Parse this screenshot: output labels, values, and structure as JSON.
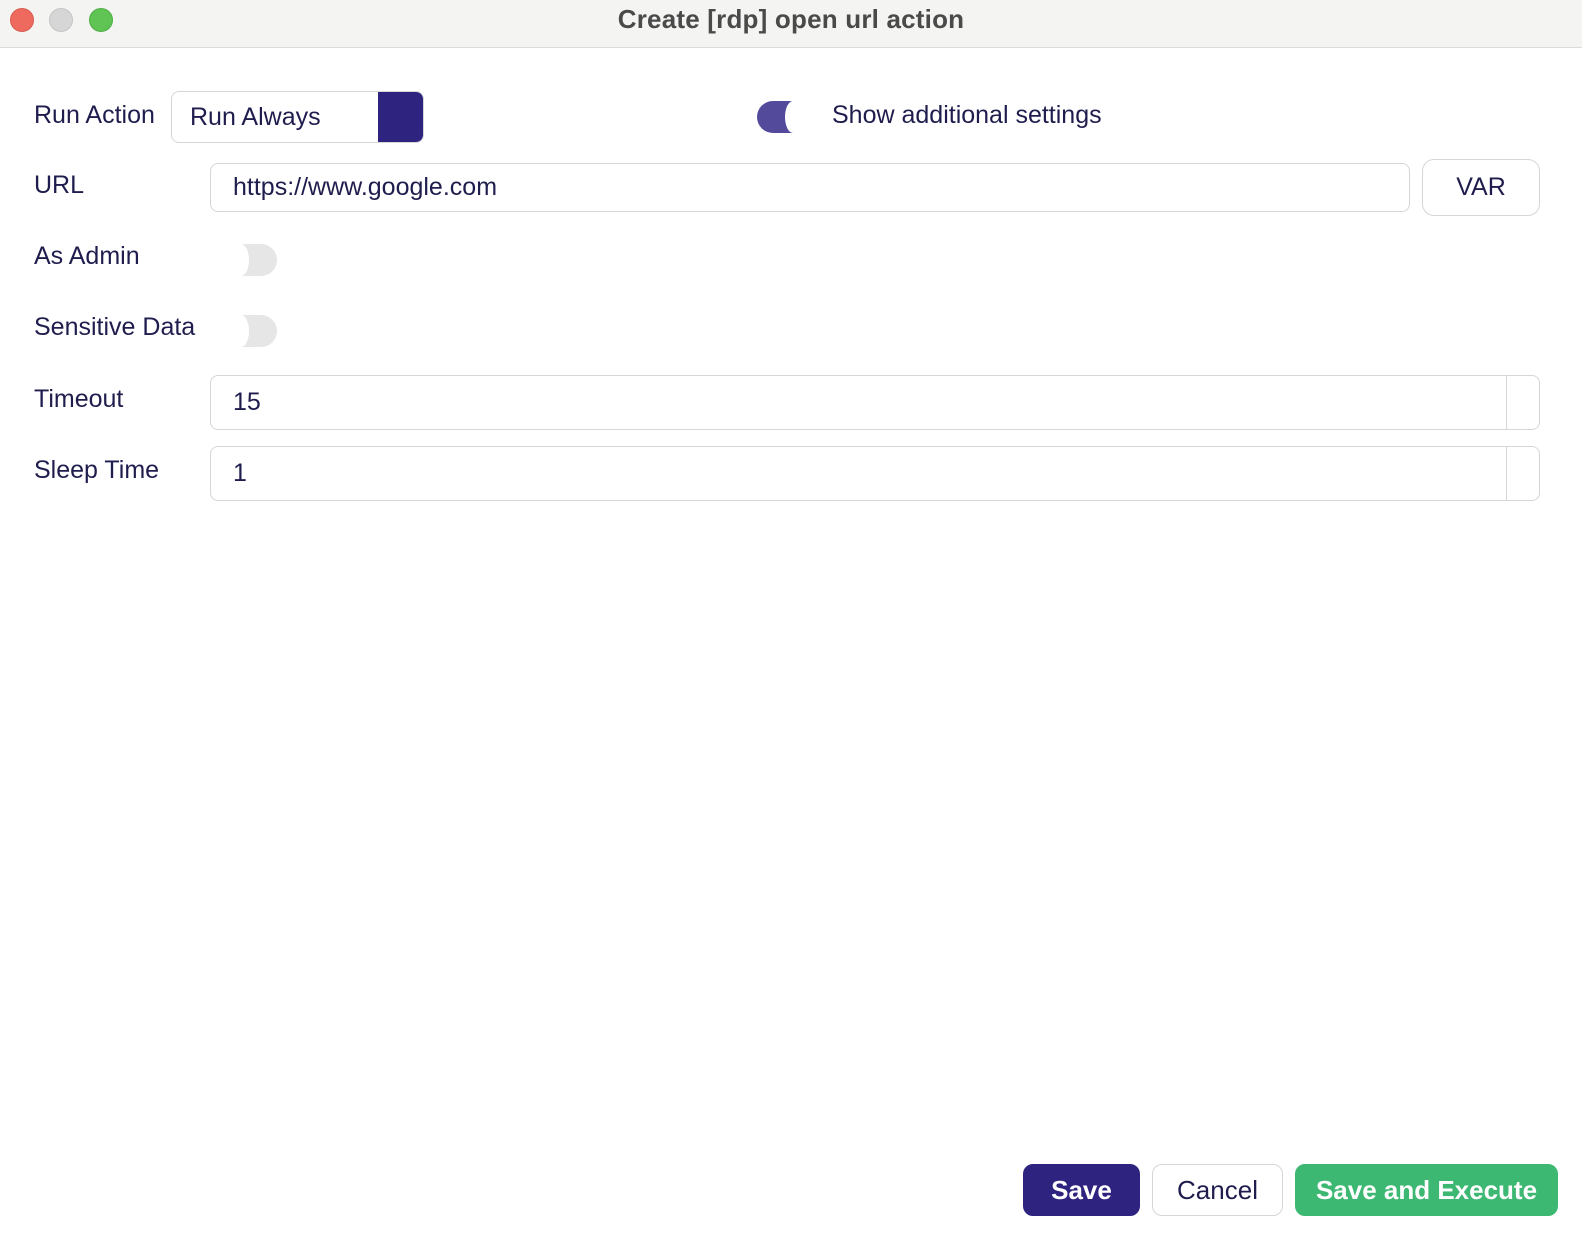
{
  "window": {
    "title": "Create [rdp] open url action"
  },
  "form": {
    "run_action": {
      "label": "Run Action",
      "value": "Run Always"
    },
    "show_additional": {
      "label": "Show additional settings",
      "enabled": true
    },
    "url": {
      "label": "URL",
      "value": "https://www.google.com",
      "var_button": "VAR"
    },
    "as_admin": {
      "label": "As Admin",
      "enabled": false
    },
    "sensitive_data": {
      "label": "Sensitive Data",
      "enabled": false
    },
    "timeout": {
      "label": "Timeout",
      "value": "15"
    },
    "sleep_time": {
      "label": "Sleep Time",
      "value": "1"
    }
  },
  "footer": {
    "save_label": "Save",
    "cancel_label": "Cancel",
    "save_execute_label": "Save and Execute"
  },
  "colors": {
    "primary": "#2e2480",
    "toggle_on": "#534a9c",
    "success": "#3cb872",
    "text": "#1f1d4d"
  }
}
